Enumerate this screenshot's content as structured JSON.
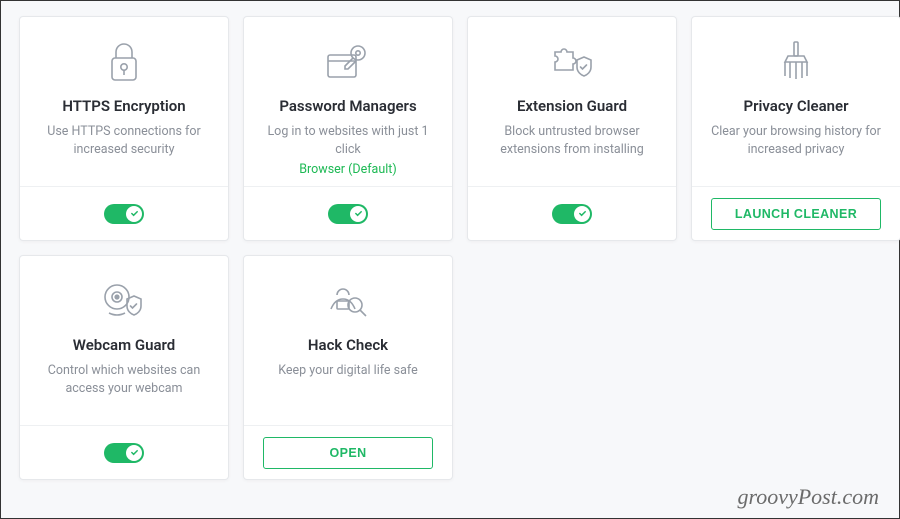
{
  "cards": [
    {
      "title": "HTTPS Encryption",
      "desc": "Use HTTPS connections for increased security",
      "extra": "",
      "action_type": "toggle",
      "action_label": ""
    },
    {
      "title": "Password Managers",
      "desc": "Log in to websites with just 1 click",
      "extra": "Browser (Default)",
      "action_type": "toggle",
      "action_label": ""
    },
    {
      "title": "Extension Guard",
      "desc": "Block untrusted browser extensions from installing",
      "extra": "",
      "action_type": "toggle",
      "action_label": ""
    },
    {
      "title": "Privacy Cleaner",
      "desc": "Clear your browsing history for increased privacy",
      "extra": "",
      "action_type": "button",
      "action_label": "LAUNCH CLEANER"
    },
    {
      "title": "Webcam Guard",
      "desc": "Control which websites can access your webcam",
      "extra": "",
      "action_type": "toggle",
      "action_label": ""
    },
    {
      "title": "Hack Check",
      "desc": "Keep your digital life safe",
      "extra": "",
      "action_type": "button",
      "action_label": "OPEN"
    }
  ],
  "watermark": "groovyPost.com"
}
